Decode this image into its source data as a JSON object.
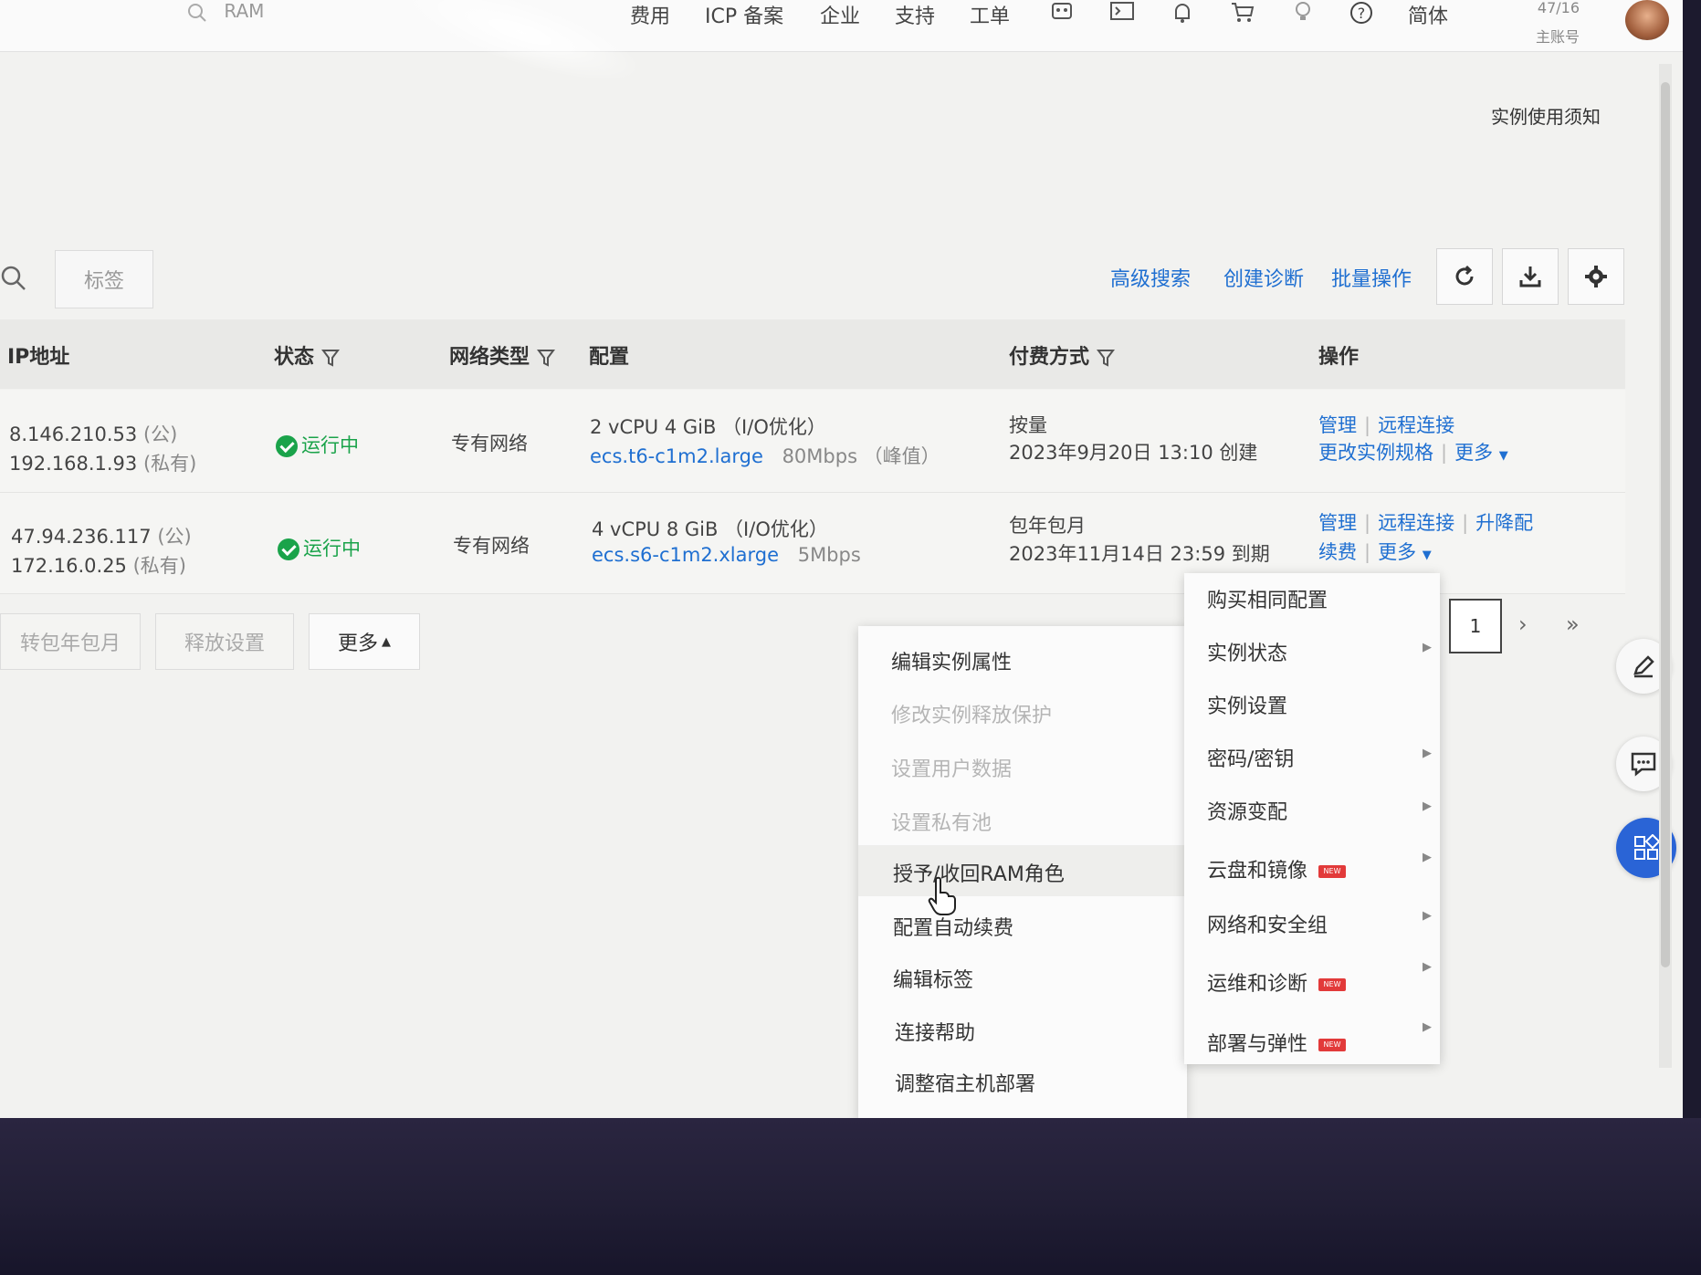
{
  "topbar": {
    "search_placeholder": "RAM",
    "nav": [
      "费用",
      "ICP 备案",
      "企业",
      "支持",
      "工单"
    ],
    "language": "简体",
    "account_line1": "47/16",
    "account_line2": "主账号"
  },
  "notice": "实例使用须知",
  "toolbar": {
    "tag_label": "标签",
    "links": [
      "高级搜索",
      "创建诊断",
      "批量操作"
    ]
  },
  "table": {
    "headers": {
      "ip": "IP地址",
      "status": "状态",
      "network": "网络类型",
      "config": "配置",
      "billing": "付费方式",
      "actions": "操作"
    },
    "rows": [
      {
        "ip_public": "8.146.210.53",
        "ip_public_tag": "(公)",
        "ip_private": "192.168.1.93",
        "ip_private_tag": "(私有)",
        "status": "运行中",
        "network": "专有网络",
        "spec": "2 vCPU 4 GiB （I/O优化）",
        "type": "ecs.t6-c1m2.large",
        "bandwidth": "80Mbps （峰值）",
        "billing": "按量",
        "billing_date": "2023年9月20日 13:10 创建",
        "actions": [
          "管理",
          "远程连接"
        ],
        "actions2": [
          "更改实例规格",
          "更多"
        ]
      },
      {
        "ip_public": "47.94.236.117",
        "ip_public_tag": "(公)",
        "ip_private": "172.16.0.25",
        "ip_private_tag": "(私有)",
        "status": "运行中",
        "network": "专有网络",
        "spec": "4 vCPU 8 GiB （I/O优化）",
        "type": "ecs.s6-c1m2.xlarge",
        "bandwidth": "5Mbps",
        "billing": "包年包月",
        "billing_date": "2023年11月14日 23:59 到期",
        "actions": [
          "管理",
          "远程连接",
          "升降配"
        ],
        "actions2": [
          "续费",
          "更多"
        ]
      }
    ]
  },
  "bottom_actions": [
    "转包年包月",
    "释放设置",
    "更多"
  ],
  "pagination": {
    "current": "1"
  },
  "submenu_left": [
    {
      "label": "编辑实例属性",
      "disabled": false
    },
    {
      "label": "修改实例释放保护",
      "disabled": true
    },
    {
      "label": "设置用户数据",
      "disabled": true
    },
    {
      "label": "设置私有池",
      "disabled": true
    },
    {
      "label": "授予/收回RAM角色",
      "disabled": false
    },
    {
      "label": "配置自动续费",
      "disabled": false
    },
    {
      "label": "编辑标签",
      "disabled": false
    },
    {
      "label": "连接帮助",
      "disabled": false
    },
    {
      "label": "调整宿主机部署",
      "disabled": false
    }
  ],
  "submenu_right": [
    {
      "label": "购买相同配置",
      "arrow": false,
      "new": false
    },
    {
      "label": "实例状态",
      "arrow": true,
      "new": false
    },
    {
      "label": "实例设置",
      "arrow": false,
      "new": false
    },
    {
      "label": "密码/密钥",
      "arrow": true,
      "new": false
    },
    {
      "label": "资源变配",
      "arrow": true,
      "new": false
    },
    {
      "label": "云盘和镜像",
      "arrow": true,
      "new": true
    },
    {
      "label": "网络和安全组",
      "arrow": true,
      "new": false
    },
    {
      "label": "运维和诊断",
      "arrow": true,
      "new": true
    },
    {
      "label": "部署与弹性",
      "arrow": true,
      "new": true
    }
  ],
  "badge_text": "NEW",
  "colors": {
    "link": "#1f6fd1",
    "running": "#1aa34a",
    "badge": "#e23a3a",
    "float_primary": "#2a64d6"
  }
}
